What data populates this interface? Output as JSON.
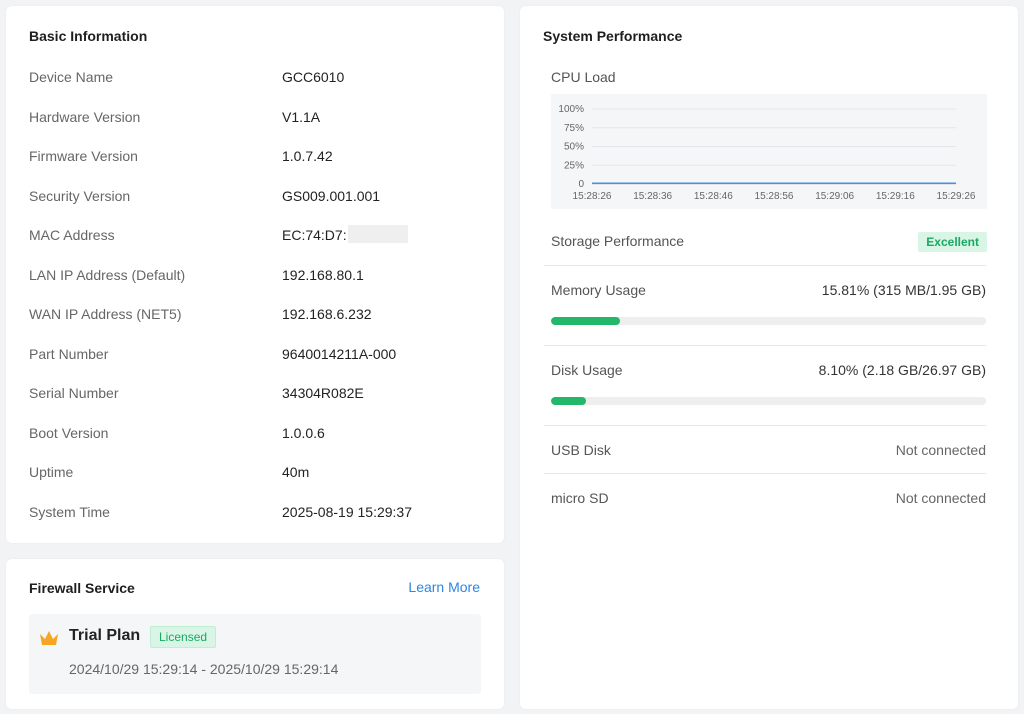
{
  "basic": {
    "title": "Basic Information",
    "rows": [
      {
        "label": "Device Name",
        "value": "GCC6010"
      },
      {
        "label": "Hardware Version",
        "value": "V1.1A"
      },
      {
        "label": "Firmware Version",
        "value": "1.0.7.42"
      },
      {
        "label": "Security Version",
        "value": "GS009.001.001"
      },
      {
        "label": "MAC Address",
        "value": "EC:74:D7:"
      },
      {
        "label": "LAN IP Address (Default)",
        "value": "192.168.80.1"
      },
      {
        "label": "WAN IP Address (NET5)",
        "value": "192.168.6.232"
      },
      {
        "label": "Part Number",
        "value": "9640014211A-000"
      },
      {
        "label": "Serial Number",
        "value": "34304R082E"
      },
      {
        "label": "Boot Version",
        "value": "1.0.0.6"
      },
      {
        "label": "Uptime",
        "value": "40m"
      },
      {
        "label": "System Time",
        "value": "2025-08-19 15:29:37"
      }
    ]
  },
  "firewall": {
    "title": "Firewall Service",
    "learn_more": "Learn More",
    "plan_name": "Trial Plan",
    "plan_badge": "Licensed",
    "plan_dates": "2024/10/29 15:29:14 - 2025/10/29 15:29:14",
    "crown_color": "#f5a623"
  },
  "performance": {
    "title": "System Performance",
    "cpu_label": "CPU Load",
    "storage_label": "Storage Performance",
    "storage_badge": "Excellent",
    "memory_label": "Memory Usage",
    "memory_value": "15.81% (315 MB/1.95 GB)",
    "memory_fraction": 0.1581,
    "disk_label": "Disk Usage",
    "disk_value": "8.10% (2.18 GB/26.97 GB)",
    "disk_fraction": 0.081,
    "usb_label": "USB Disk",
    "usb_value": "Not connected",
    "sd_label": "micro SD",
    "sd_value": "Not connected",
    "accent": "#22b76a"
  },
  "chart_data": {
    "type": "line",
    "x": [
      "15:28:26",
      "15:28:36",
      "15:28:46",
      "15:28:56",
      "15:29:06",
      "15:29:16",
      "15:29:26"
    ],
    "series": [
      {
        "values": [
          1,
          1,
          1,
          1,
          1,
          1,
          1
        ]
      }
    ],
    "yticks": [
      "100%",
      "75%",
      "50%",
      "25%",
      "0"
    ],
    "ylim": [
      0,
      100
    ],
    "grid": true,
    "line_color": "#4a90e2"
  }
}
